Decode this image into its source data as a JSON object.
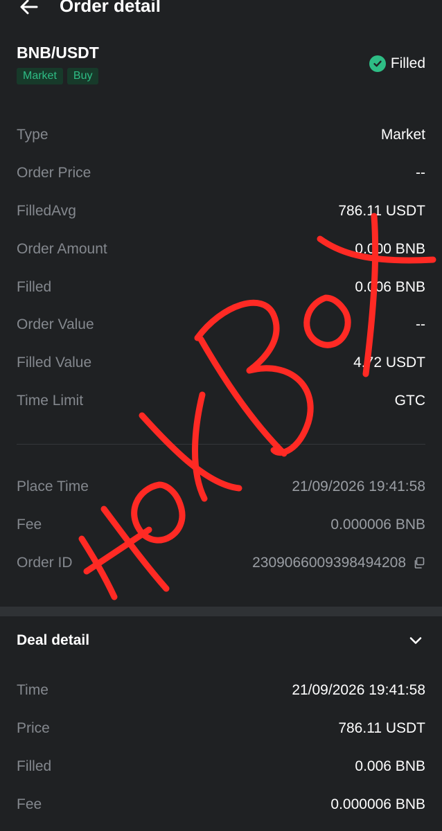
{
  "header": {
    "title": "Order detail"
  },
  "order": {
    "pair": "BNB/USDT",
    "tags": [
      "Market",
      "Buy"
    ],
    "status": "Filled",
    "details": [
      {
        "label": "Type",
        "value": "Market"
      },
      {
        "label": "Order Price",
        "value": "--"
      },
      {
        "label": "FilledAvg",
        "value": "786.11 USDT"
      },
      {
        "label": "Order Amount",
        "value": "0.000 BNB"
      },
      {
        "label": "Filled",
        "value": "0.006 BNB"
      },
      {
        "label": "Order Value",
        "value": "--"
      },
      {
        "label": "Filled Value",
        "value": "4.72 USDT"
      },
      {
        "label": "Time Limit",
        "value": "GTC"
      }
    ],
    "meta": [
      {
        "label": "Place Time",
        "value": "21/09/2026 19:41:58"
      },
      {
        "label": "Fee",
        "value": "0.000006 BNB"
      },
      {
        "label": "Order ID",
        "value": "2309066009398494208"
      }
    ]
  },
  "deal": {
    "title": "Deal detail",
    "rows": [
      {
        "label": "Time",
        "value": "21/09/2026 19:41:58"
      },
      {
        "label": "Price",
        "value": "786.11 USDT"
      },
      {
        "label": "Filled",
        "value": "0.006 BNB"
      },
      {
        "label": "Fee",
        "value": "0.000006 BNB"
      }
    ]
  },
  "watermark": {
    "text": "HotBot",
    "color": "#ff2a24"
  },
  "colors": {
    "accent": "#2ebd85",
    "background": "#1f2123"
  }
}
